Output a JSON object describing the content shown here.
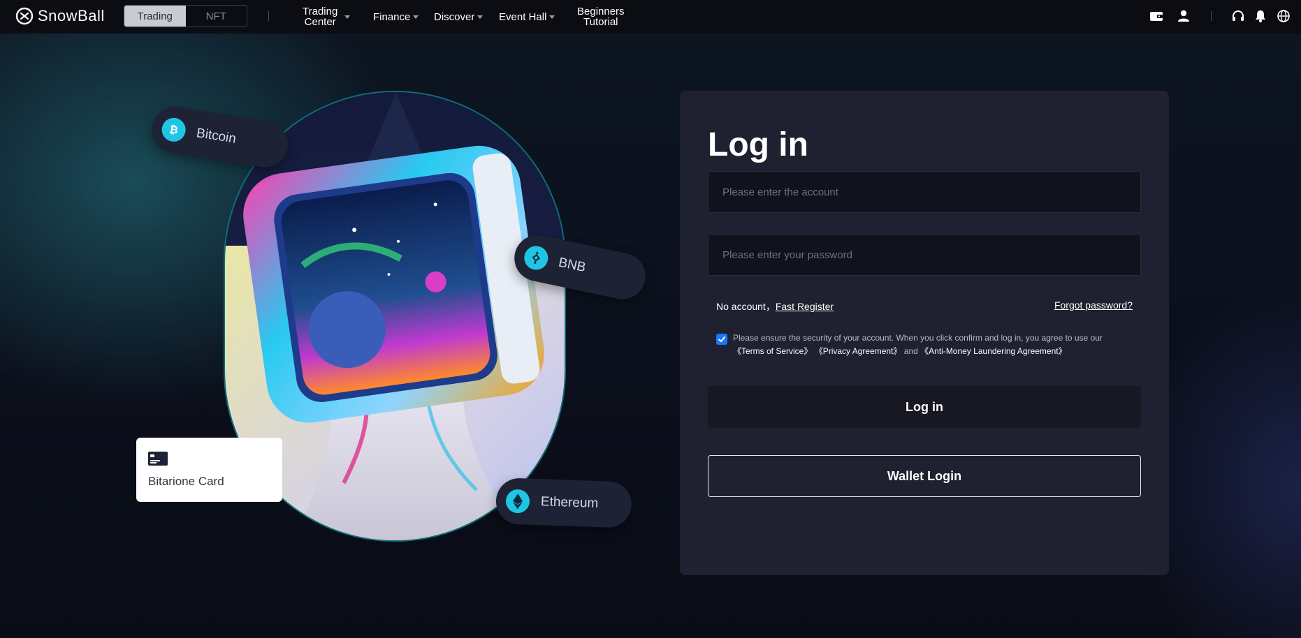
{
  "brand": {
    "name": "SnowBall"
  },
  "header": {
    "mode_tabs": [
      {
        "label": "Trading",
        "active": true
      },
      {
        "label": "NFT",
        "active": false
      }
    ],
    "nav": {
      "trading_center_line1": "Trading",
      "trading_center_line2": "Center",
      "finance": "Finance",
      "discover": "Discover",
      "event_hall": "Event Hall",
      "tutorial_line1": "Beginners",
      "tutorial_line2": "Tutorial"
    },
    "icons": [
      "wallet-icon",
      "user-icon",
      "headset-icon",
      "bell-icon",
      "globe-icon"
    ]
  },
  "hero": {
    "pills": {
      "bitcoin": "Bitcoin",
      "bnb": "BNB",
      "ethereum": "Ethereum"
    },
    "card_label": "Bitarione Card"
  },
  "login": {
    "title": "Log in",
    "account_placeholder": "Please enter the account",
    "password_placeholder": "Please enter your password",
    "no_account_text": "No account，",
    "register_link": "Fast Register",
    "forgot_link": "Forgot password?",
    "agreement_checked": true,
    "agreement_text": "Please ensure the security of your account. When you click confirm and log in, you agree to use our",
    "terms": "《Terms of Service》",
    "privacy": "《Privacy Agreement》",
    "and_text": "and",
    "aml": "《Anti-Money Laundering Agreement》",
    "login_button": "Log in",
    "wallet_button": "Wallet Login"
  },
  "colors": {
    "accent_cyan": "#1fc5e4",
    "checkbox_blue": "#1677ff",
    "panel_bg": "#1f2030"
  }
}
